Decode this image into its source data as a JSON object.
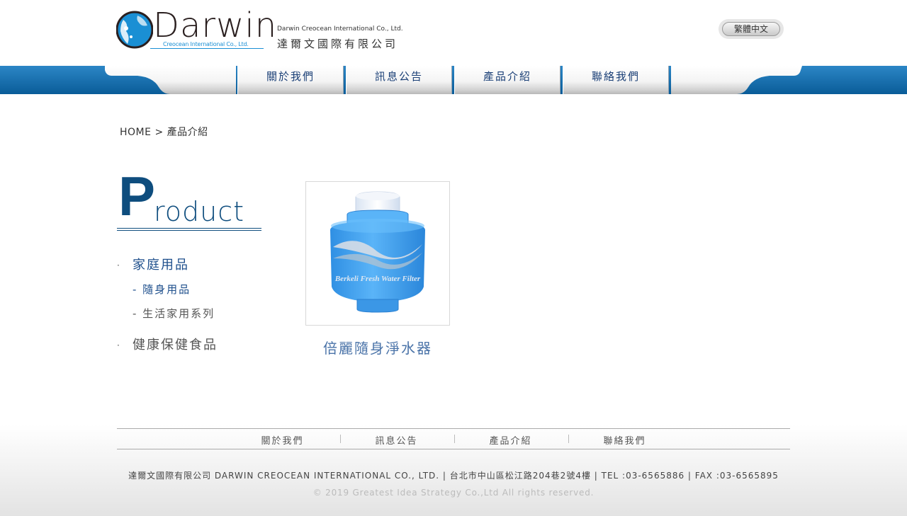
{
  "header": {
    "logo_word": "Darwin",
    "logo_sub": "Creocean International Co., Ltd.",
    "company_en": "Darwin Creocean International Co., Ltd.",
    "company_zh": "達爾文國際有限公司",
    "language_button": "繁體中文"
  },
  "nav": {
    "items": [
      "關於我們",
      "訊息公告",
      "產品介紹",
      "聯絡我們"
    ]
  },
  "breadcrumb": {
    "home": "HOME",
    "separator": ">",
    "current": "產品介紹"
  },
  "sidebar": {
    "title_initial": "P",
    "title_rest": "roduct",
    "categories": [
      {
        "label": "家庭用品",
        "subcategories": [
          "- 隨身用品",
          "- 生活家用系列"
        ]
      },
      {
        "label": "健康保健食品"
      }
    ],
    "bullet": "·"
  },
  "products": [
    {
      "name": "倍麗隨身淨水器",
      "image_label": "Berkeli Fresh Water Filter"
    }
  ],
  "footer": {
    "links": [
      "關於我們",
      "訊息公告",
      "產品介紹",
      "聯絡我們"
    ],
    "info": "達爾文國際有限公司 DARWIN CREOCEAN INTERNATIONAL CO., LTD. | 台北市中山區松江路204巷2號4樓 | TEL :03-6565886 | FAX :03-6565895",
    "copyright": "© 2019 Greatest Idea Strategy Co.,Ltd All rights reserved."
  },
  "colors": {
    "nav_blue": "#0a5c98",
    "title_navy": "#0e4d7e",
    "link_blue": "#1e4f8c",
    "product_name": "#4a73a8",
    "logo_blue": "#1a8fd4"
  }
}
